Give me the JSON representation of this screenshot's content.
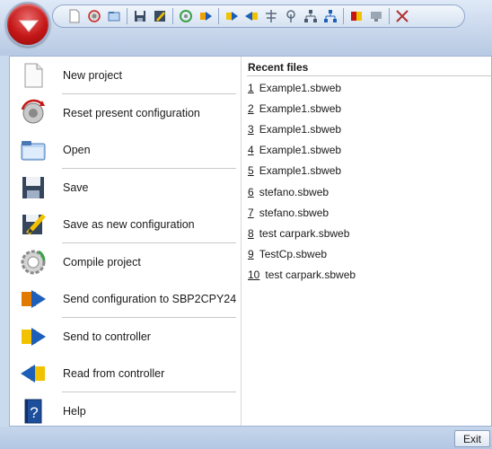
{
  "toolbar": {
    "icons": [
      "new-doc-icon",
      "reset-icon",
      "open-icon",
      "save-icon",
      "save-as-icon",
      "compile-icon",
      "send-config-icon",
      "send-icon",
      "read-icon",
      "network-icon",
      "antenna-icon",
      "tree-icon",
      "tree-blue-icon",
      "flag-icon",
      "monitor-icon",
      "tools-icon"
    ]
  },
  "menu": {
    "commands": [
      {
        "label": "New project",
        "icon": "new-project-icon"
      },
      {
        "label": "Reset present configuration",
        "icon": "reset-config-icon"
      },
      {
        "label": "Open",
        "icon": "open-folder-icon"
      },
      {
        "label": "Save",
        "icon": "floppy-disk-icon"
      },
      {
        "label": "Save as new configuration",
        "icon": "save-as-icon"
      },
      {
        "label": "Compile project",
        "icon": "compile-gear-icon"
      },
      {
        "label": "Send configuration to SBP2CPY24",
        "icon": "send-configuration-icon"
      },
      {
        "label": "Send to controller",
        "icon": "send-arrow-icon"
      },
      {
        "label": "Read from controller",
        "icon": "read-arrow-icon"
      },
      {
        "label": "Help",
        "icon": "help-book-icon"
      }
    ]
  },
  "recent": {
    "title": "Recent files",
    "files": [
      {
        "num": "1",
        "name": "Example1.sbweb"
      },
      {
        "num": "2",
        "name": "Example1.sbweb"
      },
      {
        "num": "3",
        "name": "Example1.sbweb"
      },
      {
        "num": "4",
        "name": "Example1.sbweb"
      },
      {
        "num": "5",
        "name": "Example1.sbweb"
      },
      {
        "num": "6",
        "name": "stefano.sbweb"
      },
      {
        "num": "7",
        "name": "stefano.sbweb"
      },
      {
        "num": "8",
        "name": "test carpark.sbweb"
      },
      {
        "num": "9",
        "name": "TestCp.sbweb"
      },
      {
        "num": "10",
        "name": "test carpark.sbweb"
      }
    ]
  },
  "footer": {
    "exit_label": "Exit"
  },
  "colors": {
    "orb": "#c41616",
    "frame": "#c9d9ee",
    "panel": "#ffffff"
  }
}
